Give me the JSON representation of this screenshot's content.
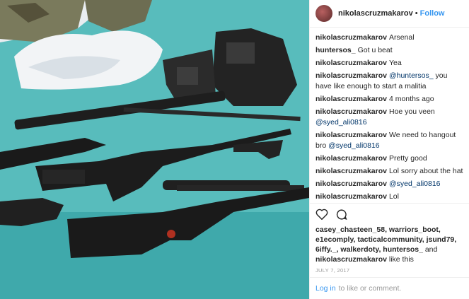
{
  "header": {
    "username": "nikolascruzmakarov",
    "dot": "•",
    "follow_label": "Follow"
  },
  "comments": [
    {
      "user": "nikolascruzmakarov",
      "text": "Arsenal",
      "mention": ""
    },
    {
      "user": "huntersos_",
      "text": "Got u beat",
      "mention": ""
    },
    {
      "user": "nikolascruzmakarov",
      "text": "Yea",
      "mention": ""
    },
    {
      "user": "nikolascruzmakarov",
      "mention": "@huntersos_",
      "text": " you have like enough to start a malitia"
    },
    {
      "user": "nikolascruzmakarov",
      "text": "4 months ago",
      "mention": ""
    },
    {
      "user": "nikolascruzmakarov",
      "text": "Hoe you veen ",
      "mention_after": "@syed_ali0816"
    },
    {
      "user": "nikolascruzmakarov",
      "text": "We need to hangout bro ",
      "mention_after": "@syed_ali0816"
    },
    {
      "user": "nikolascruzmakarov",
      "text": "Pretty good",
      "mention": ""
    },
    {
      "user": "nikolascruzmakarov",
      "text": "Lol sorry about the hat",
      "mention": ""
    },
    {
      "user": "nikolascruzmakarov",
      "mention": "@syed_ali0816",
      "text": ""
    },
    {
      "user": "nikolascruzmakarov",
      "text": "Lol",
      "mention": ""
    }
  ],
  "actions": {
    "like_icon": "heart-icon",
    "comment_icon": "speech-bubble-icon"
  },
  "likes": {
    "names": "casey_chasteen_58, warriors_boot, e1ecomply, tacticalcommunity, jsund79, 6iffy._, walkerdoty, huntersos_",
    "and": " and ",
    "last": "nikolascruzmakarov",
    "suffix": " like this"
  },
  "date": "JULY 7, 2017",
  "footer": {
    "login_label": "Log in",
    "rest": "to like or comment."
  },
  "colors": {
    "link": "#3897f0",
    "mention": "#003569",
    "bedsheet": "#4fb6b7"
  }
}
